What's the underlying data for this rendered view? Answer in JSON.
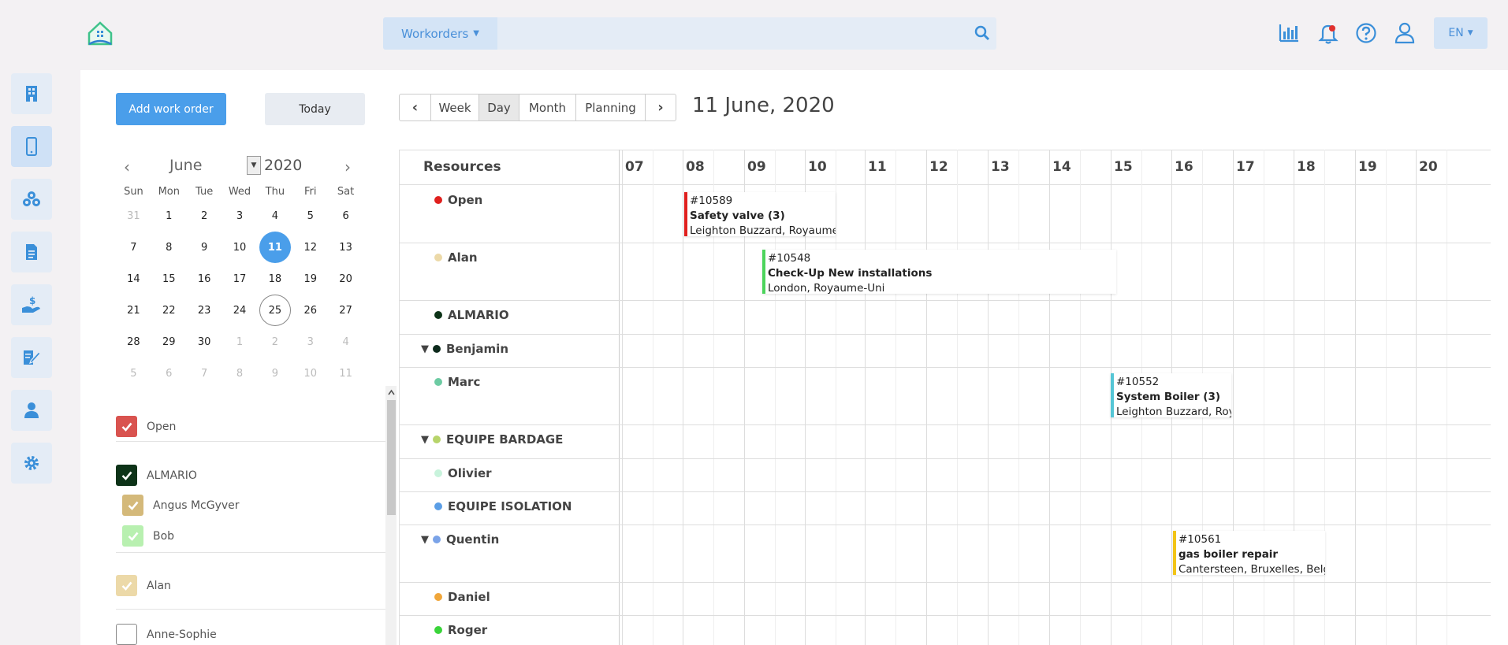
{
  "topbar": {
    "search_dropdown": "Workorders",
    "search_placeholder": "",
    "lang": "EN"
  },
  "toolbar": {
    "add_label": "Add work order",
    "today_label": "Today",
    "views": [
      "Week",
      "Day",
      "Month",
      "Planning"
    ],
    "active_view": "Day",
    "current_date": "11 June, 2020"
  },
  "mini_calendar": {
    "month": "June",
    "year": "2020",
    "weekdays": [
      "Sun",
      "Mon",
      "Tue",
      "Wed",
      "Thu",
      "Fri",
      "Sat"
    ],
    "days": [
      [
        "31",
        "other"
      ],
      [
        "1",
        ""
      ],
      [
        "2",
        ""
      ],
      [
        "3",
        ""
      ],
      [
        "4",
        ""
      ],
      [
        "5",
        ""
      ],
      [
        "6",
        ""
      ],
      [
        "7",
        ""
      ],
      [
        "8",
        ""
      ],
      [
        "9",
        ""
      ],
      [
        "10",
        ""
      ],
      [
        "11",
        "sel"
      ],
      [
        "12",
        ""
      ],
      [
        "13",
        ""
      ],
      [
        "14",
        ""
      ],
      [
        "15",
        ""
      ],
      [
        "16",
        ""
      ],
      [
        "17",
        ""
      ],
      [
        "18",
        ""
      ],
      [
        "19",
        ""
      ],
      [
        "20",
        ""
      ],
      [
        "21",
        ""
      ],
      [
        "22",
        ""
      ],
      [
        "23",
        ""
      ],
      [
        "24",
        ""
      ],
      [
        "25",
        "ring"
      ],
      [
        "26",
        ""
      ],
      [
        "27",
        ""
      ],
      [
        "28",
        ""
      ],
      [
        "29",
        ""
      ],
      [
        "30",
        ""
      ],
      [
        "1",
        "other"
      ],
      [
        "2",
        "other"
      ],
      [
        "3",
        "other"
      ],
      [
        "4",
        "other"
      ],
      [
        "5",
        "other"
      ],
      [
        "6",
        "other"
      ],
      [
        "7",
        "other"
      ],
      [
        "8",
        "other"
      ],
      [
        "9",
        "other"
      ],
      [
        "10",
        "other"
      ],
      [
        "11",
        "other"
      ]
    ]
  },
  "filters": [
    {
      "label": "Open",
      "checked": true,
      "color": "#d9534f"
    },
    {
      "label": "ALMARIO",
      "checked": true,
      "color": "#0d3318"
    },
    {
      "label": "Angus McGyver",
      "checked": true,
      "color": "#d4b97a"
    },
    {
      "label": "Bob",
      "checked": true,
      "color": "#b8f0b0"
    },
    {
      "label": "Alan",
      "checked": true,
      "color": "#ecd9a8"
    },
    {
      "label": "Anne-Sophie",
      "checked": false,
      "color": "#ffffff"
    }
  ],
  "timeline": {
    "resources_label": "Resources",
    "hours": [
      "07",
      "08",
      "09",
      "10",
      "11",
      "12",
      "13",
      "14",
      "15",
      "16",
      "17",
      "18",
      "19",
      "20"
    ],
    "resources": [
      {
        "name": "Open",
        "color": "#e0201e",
        "expand": false
      },
      {
        "name": "Alan",
        "color": "#ecd9a8",
        "expand": false
      },
      {
        "name": "ALMARIO",
        "color": "#0d3318",
        "expand": false
      },
      {
        "name": "Benjamin",
        "color": "#0d2a1c",
        "expand": true
      },
      {
        "name": "Marc",
        "color": "#6dcba3",
        "expand": false
      },
      {
        "name": "EQUIPE BARDAGE",
        "color": "#b7d46a",
        "expand": true
      },
      {
        "name": "Olivier",
        "color": "#c8f3dc",
        "expand": false
      },
      {
        "name": "EQUIPE ISOLATION",
        "color": "#5b9ee6",
        "expand": false
      },
      {
        "name": "Quentin",
        "color": "#7aa3e8",
        "expand": true
      },
      {
        "name": "Daniel",
        "color": "#f0a63a",
        "expand": false
      },
      {
        "name": "Roger",
        "color": "#3ad43a",
        "expand": false
      }
    ],
    "events": [
      {
        "id": "#10589",
        "title": "Safety valve (3)",
        "location": "Leighton Buzzard, Royaume-Uni",
        "color": "#e0201e",
        "resource": "Open"
      },
      {
        "id": "#10548",
        "title": "Check-Up New installations",
        "location": "London, Royaume-Uni",
        "color": "#4cd45c",
        "resource": "Alan"
      },
      {
        "id": "#10552",
        "title": "System Boiler (3)",
        "location": "Leighton Buzzard, Royaume-Uni",
        "color": "#55c6d6",
        "resource": "Marc"
      },
      {
        "id": "#10561",
        "title": "gas boiler repair",
        "location": "Cantersteen, Bruxelles, Belgique",
        "color": "#f2c417",
        "resource": "Quentin"
      }
    ]
  },
  "icons": {
    "sidebar": [
      "building-icon",
      "mobile-icon",
      "boxes-icon",
      "document-icon",
      "hand-money-icon",
      "edit-document-icon",
      "user-icon",
      "gear-icon"
    ],
    "top": [
      "chart-icon",
      "bell-icon",
      "help-icon",
      "profile-icon"
    ]
  }
}
